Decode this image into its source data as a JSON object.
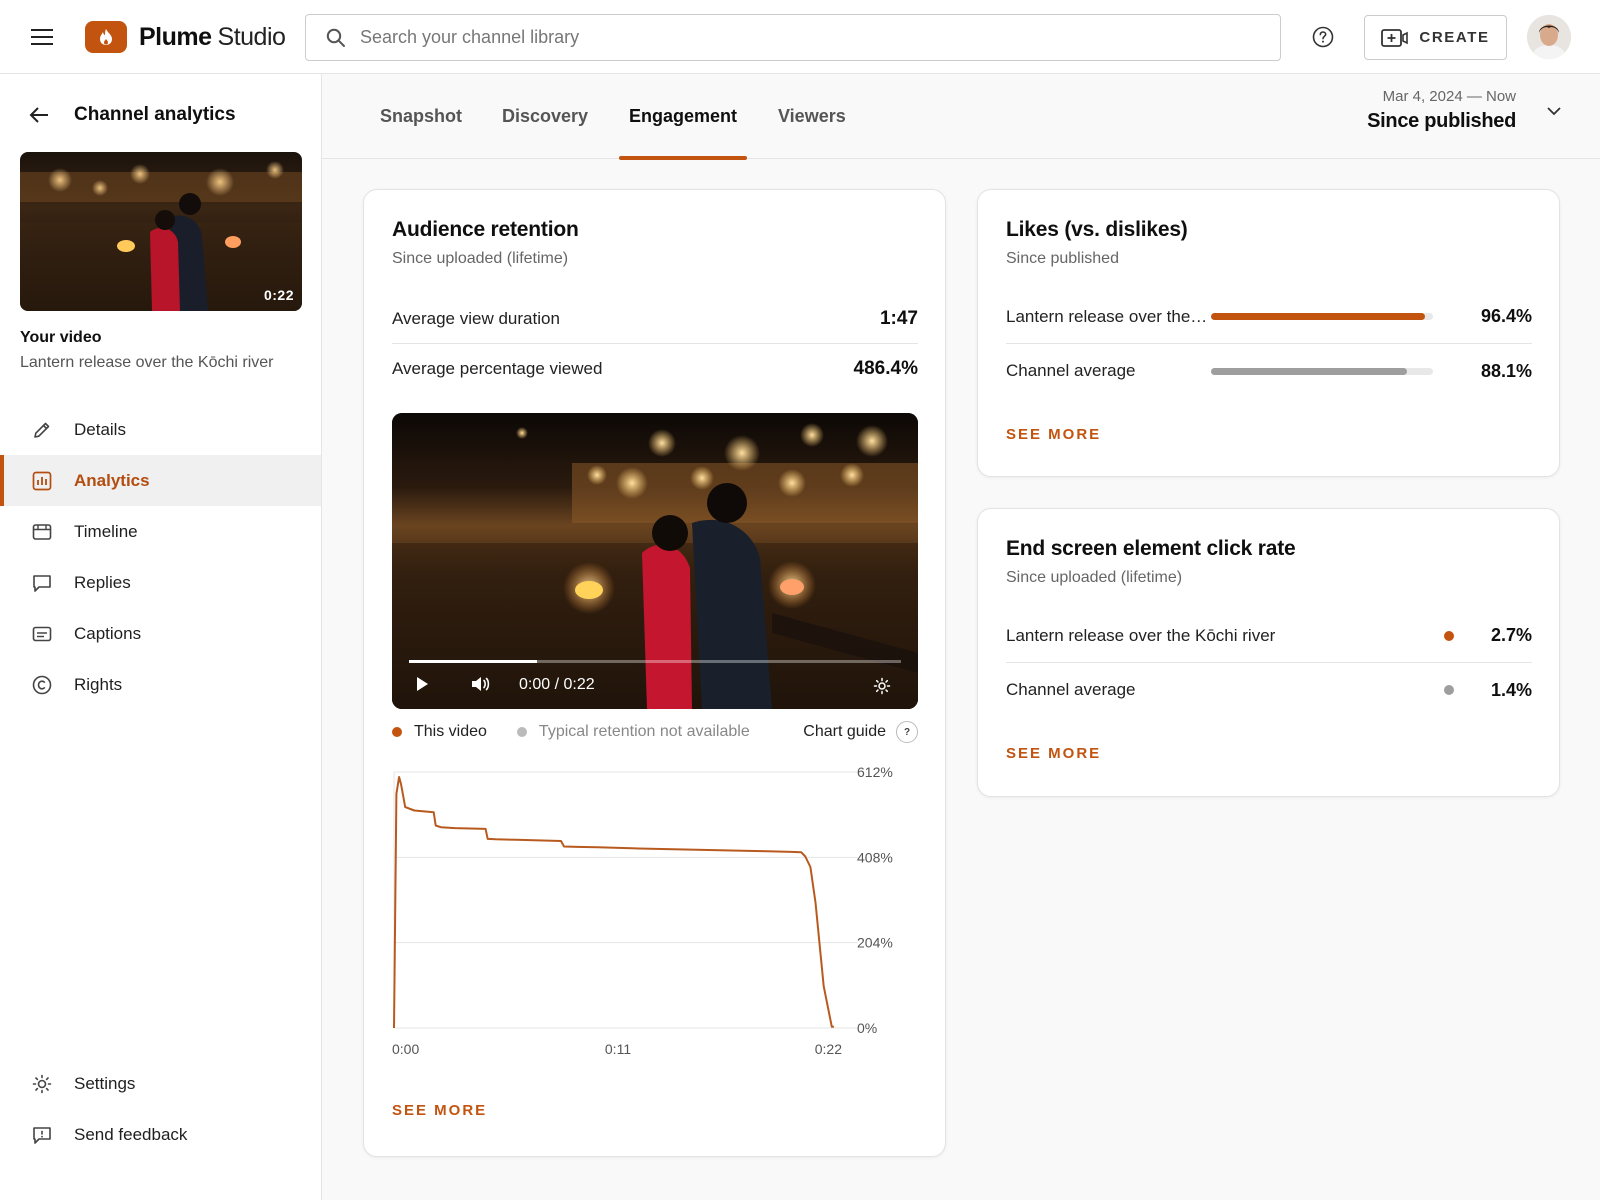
{
  "app": {
    "brand_bold": "Plume",
    "brand_regular": "Studio",
    "search_placeholder": "Search your channel library",
    "create_label": "CREATE"
  },
  "sidebar": {
    "title": "Channel analytics",
    "thumb_duration": "0:22",
    "your_video_label": "Your video",
    "video_title": "Lantern release over the Kōchi river",
    "items": [
      {
        "label": "Details",
        "icon": "pencil-icon"
      },
      {
        "label": "Analytics",
        "icon": "analytics-icon",
        "active": true
      },
      {
        "label": "Timeline",
        "icon": "timeline-icon"
      },
      {
        "label": "Replies",
        "icon": "comment-icon"
      },
      {
        "label": "Captions",
        "icon": "captions-icon"
      },
      {
        "label": "Rights",
        "icon": "copyright-icon"
      }
    ],
    "bottom_items": [
      {
        "label": "Settings",
        "icon": "gear-icon"
      },
      {
        "label": "Send feedback",
        "icon": "feedback-icon"
      }
    ]
  },
  "tabs": [
    {
      "label": "Snapshot"
    },
    {
      "label": "Discovery"
    },
    {
      "label": "Engagement",
      "active": true
    },
    {
      "label": "Viewers"
    }
  ],
  "date_range": {
    "range": "Mar 4, 2024 — Now",
    "label": "Since published"
  },
  "retention": {
    "title": "Audience retention",
    "subtitle": "Since uploaded (lifetime)",
    "metrics": [
      {
        "label": "Average view duration",
        "value": "1:47"
      },
      {
        "label": "Average percentage viewed",
        "value": "486.4%"
      }
    ],
    "player": {
      "time": "0:00 / 0:22",
      "progress": 0.26
    },
    "legend": {
      "this_video": "This video",
      "typical": "Typical retention not available",
      "guide": "Chart guide",
      "guide_icon": "?"
    },
    "see_more": "SEE MORE"
  },
  "chart_data": {
    "type": "line",
    "xlabel": "",
    "ylabel": "",
    "x_ticks": [
      "0:00",
      "0:11",
      "0:22"
    ],
    "y_ticks": [
      "612%",
      "408%",
      "204%",
      "0%"
    ],
    "xlim": [
      0,
      22
    ],
    "ylim": [
      0,
      612
    ],
    "grid": true,
    "series": [
      {
        "name": "This video",
        "x": [
          0,
          0.12,
          0.25,
          0.35,
          0.55,
          1.0,
          1.95,
          2.05,
          2.3,
          3.0,
          4.5,
          4.6,
          5.0,
          6.0,
          8.2,
          8.35,
          9.0,
          10.0,
          12.0,
          14.0,
          16.0,
          18.0,
          19.5,
          20.0,
          20.2,
          20.45,
          20.7,
          21.1,
          21.5,
          21.6
        ],
        "y": [
          0,
          560,
          600,
          582,
          528,
          520,
          516,
          484,
          480,
          478,
          476,
          452,
          451,
          450,
          447,
          434,
          433,
          432,
          429,
          427,
          425,
          423,
          421,
          420,
          410,
          385,
          300,
          100,
          3,
          3
        ]
      }
    ],
    "colors": {
      "this_video": "#b85a1e",
      "typical": "#bbbbbb",
      "grid": "#e6e6e6"
    }
  },
  "likes": {
    "title": "Likes (vs. dislikes)",
    "subtitle": "Since published",
    "rows": [
      {
        "label": "Lantern release over the Kōchi river",
        "value": "96.4%",
        "fraction": 0.964,
        "color": "#c2540f"
      },
      {
        "label": "Channel average",
        "value": "88.1%",
        "fraction": 0.881,
        "color": "#9e9e9e"
      }
    ],
    "see_more": "SEE MORE"
  },
  "endscreen": {
    "title": "End screen element click rate",
    "subtitle": "Since uploaded (lifetime)",
    "rows": [
      {
        "label": "Lantern release over the Kōchi river",
        "value": "2.7%",
        "color": "#c2540f"
      },
      {
        "label": "Channel average",
        "value": "1.4%",
        "color": "#9e9e9e"
      }
    ],
    "see_more": "SEE MORE"
  },
  "colors": {
    "accent": "#c2540f"
  }
}
